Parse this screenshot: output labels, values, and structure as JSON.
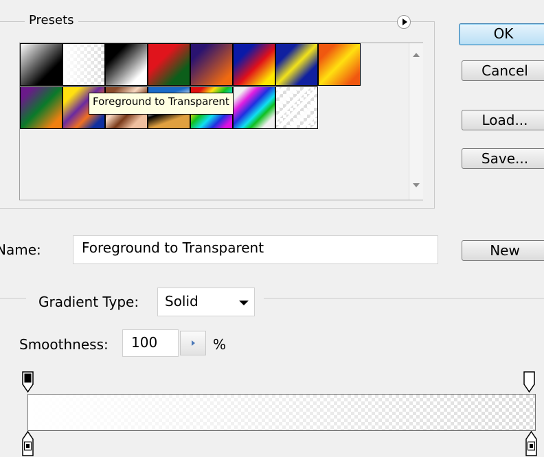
{
  "presets": {
    "title": "Presets",
    "menu_icon": "flyout-menu-icon",
    "swatches_row1": [
      {
        "name": "swatch-foreground-to-background",
        "bg": "linear-gradient(135deg,#ffffff 0%,#000000 70%)"
      },
      {
        "name": "swatch-foreground-to-transparent",
        "bg": "checker"
      },
      {
        "name": "swatch-black-white",
        "bg": "linear-gradient(135deg,#000000 25%,#ffffff 80%)"
      },
      {
        "name": "swatch-red-green",
        "bg": "linear-gradient(135deg,#e0141c 35%,#0c5e1a 75%)"
      },
      {
        "name": "swatch-violet-orange",
        "bg": "linear-gradient(135deg,#2a1370 20%,#f06a10 85%)"
      },
      {
        "name": "swatch-blue-red-yellow",
        "bg": "linear-gradient(135deg,#0a1aa8 25%,#e0101a 55%,#ffe800 85%)"
      },
      {
        "name": "swatch-blue-yellow-blue",
        "bg": "linear-gradient(135deg,#1020a0 25%,#f2e21a 50%,#1020a0 75%)"
      },
      {
        "name": "swatch-orange-yellow-orange",
        "bg": "linear-gradient(135deg,#f05810 20%,#ffe010 50%,#f05810 85%)"
      }
    ],
    "swatches_row2": [
      {
        "name": "swatch-violet-green-orange",
        "bg": "linear-gradient(135deg,#6a1a8a 15%,#0a7a2a 50%,#f08010 85%)"
      },
      {
        "name": "swatch-yellow-violet-orange-blue",
        "bg": "linear-gradient(135deg,#ffe010 20%,#6a2aa0 45%,#f07020 65%,#1030a0 85%)"
      },
      {
        "name": "swatch-copper",
        "bg": "linear-gradient(135deg,#8a4a2a 15%,#f8d8c0 40%,#7a3a1a 60%,#f0c0a0 80%)"
      },
      {
        "name": "swatch-chrome",
        "bg": "linear-gradient(160deg,#1a6ac8 25%,#ffffff 45%,#000000 55%,#e0a040 75%)"
      },
      {
        "name": "swatch-spectrum",
        "bg": "linear-gradient(135deg,#e01010 15%,#ffe010 30%,#10c020 45%,#10e0f0 60%,#2030e0 75%,#e010e0 90%)"
      },
      {
        "name": "swatch-transparent-rainbow",
        "bg": "linear-gradient(135deg,rgba(255,255,255,0) 15%,#e020e0 30%,#2030e0 45%,#10e0f0 60%,#10c020 70%,rgba(255,255,255,0) 85%)"
      },
      {
        "name": "swatch-transparent-stripes",
        "bg": "stripes"
      }
    ],
    "tooltip": "Foreground to Transparent"
  },
  "buttons": {
    "ok": "OK",
    "cancel": "Cancel",
    "load": "Load...",
    "save": "Save...",
    "new": "New"
  },
  "name_field": {
    "label": "Name:",
    "value": "Foreground to Transparent"
  },
  "gradient_type": {
    "label": "Gradient Type:",
    "value": "Solid"
  },
  "smoothness": {
    "label": "Smoothness:",
    "value": "100",
    "unit": "%"
  },
  "colors": {
    "dialog_bg": "#f0f0f0",
    "tooltip_bg": "#ffffe1",
    "default_button": "#b9dff5"
  }
}
